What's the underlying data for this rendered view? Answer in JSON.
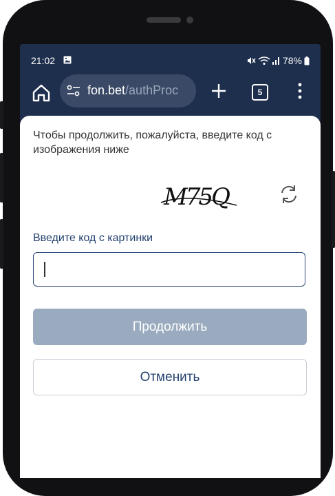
{
  "status_bar": {
    "time": "21:02",
    "battery": "78%",
    "icons": [
      "image-icon",
      "mute-icon",
      "wifi-icon",
      "signal-icon",
      "battery-icon"
    ]
  },
  "browser": {
    "url_domain": "fon.bet",
    "url_path": "/authProc",
    "tab_count": "5",
    "icons": [
      "home-icon",
      "site-settings-icon",
      "plus-icon",
      "tabs-icon",
      "more-vert-icon"
    ]
  },
  "page": {
    "instruction": "Чтобы продолжить, пожалуйста, введите код с изображения ниже",
    "captcha_text": "M75Q",
    "input_label": "Введите код с картинки",
    "input_value": "",
    "continue_label": "Продолжить",
    "cancel_label": "Отменить"
  },
  "colors": {
    "browser_bar": "#1e2f4d",
    "url_box": "#3a4a66",
    "accent": "#23416f",
    "continue_disabled": "#9aabbf"
  }
}
